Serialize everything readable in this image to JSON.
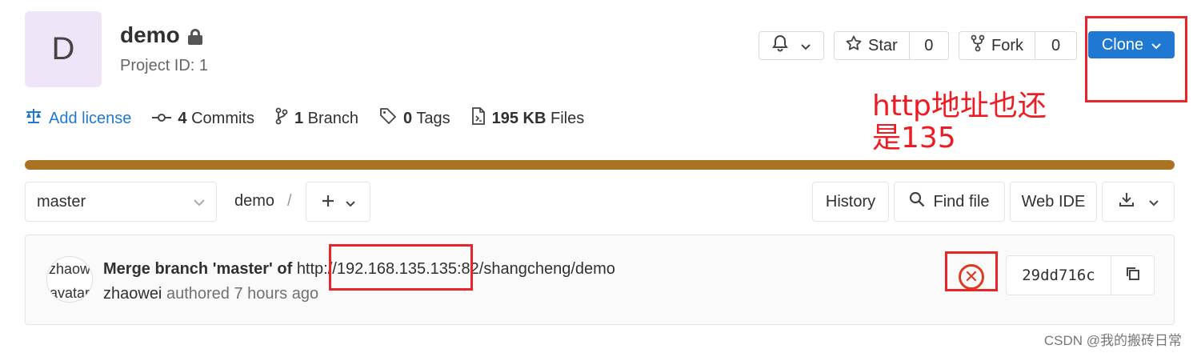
{
  "project": {
    "avatar_letter": "D",
    "name": "demo",
    "project_id": "Project ID: 1"
  },
  "header_buttons": {
    "star_label": "Star",
    "star_count": "0",
    "fork_label": "Fork",
    "fork_count": "0",
    "clone_label": "Clone"
  },
  "annotation": {
    "text": "http地址也还是135"
  },
  "stats": {
    "license": "Add license",
    "commits_count": "4",
    "commits_label": "Commits",
    "branch_count": "1",
    "branch_label": "Branch",
    "tags_count": "0",
    "tags_label": "Tags",
    "files_size": "195 KB",
    "files_label": "Files"
  },
  "toolbar": {
    "branch": "master",
    "breadcrumb": "demo",
    "separator": "/",
    "history": "History",
    "find_file": "Find file",
    "web_ide": "Web IDE"
  },
  "commit": {
    "avatar_text_1": "zhaow",
    "avatar_text_2": "avatar",
    "title_bold": "Merge branch 'master' of",
    "title_url": "http://192.168.135.135:82/shangcheng/demo",
    "author": "zhaowei",
    "authored": "authored 7 hours ago",
    "sha": "29dd716c"
  },
  "watermark": "CSDN @我的搬砖日常",
  "colors": {
    "accent": "#1f78d1",
    "progress": "#aa7223",
    "annotation_red": "#e8262a",
    "pipeline_failed": "#db3b21"
  }
}
